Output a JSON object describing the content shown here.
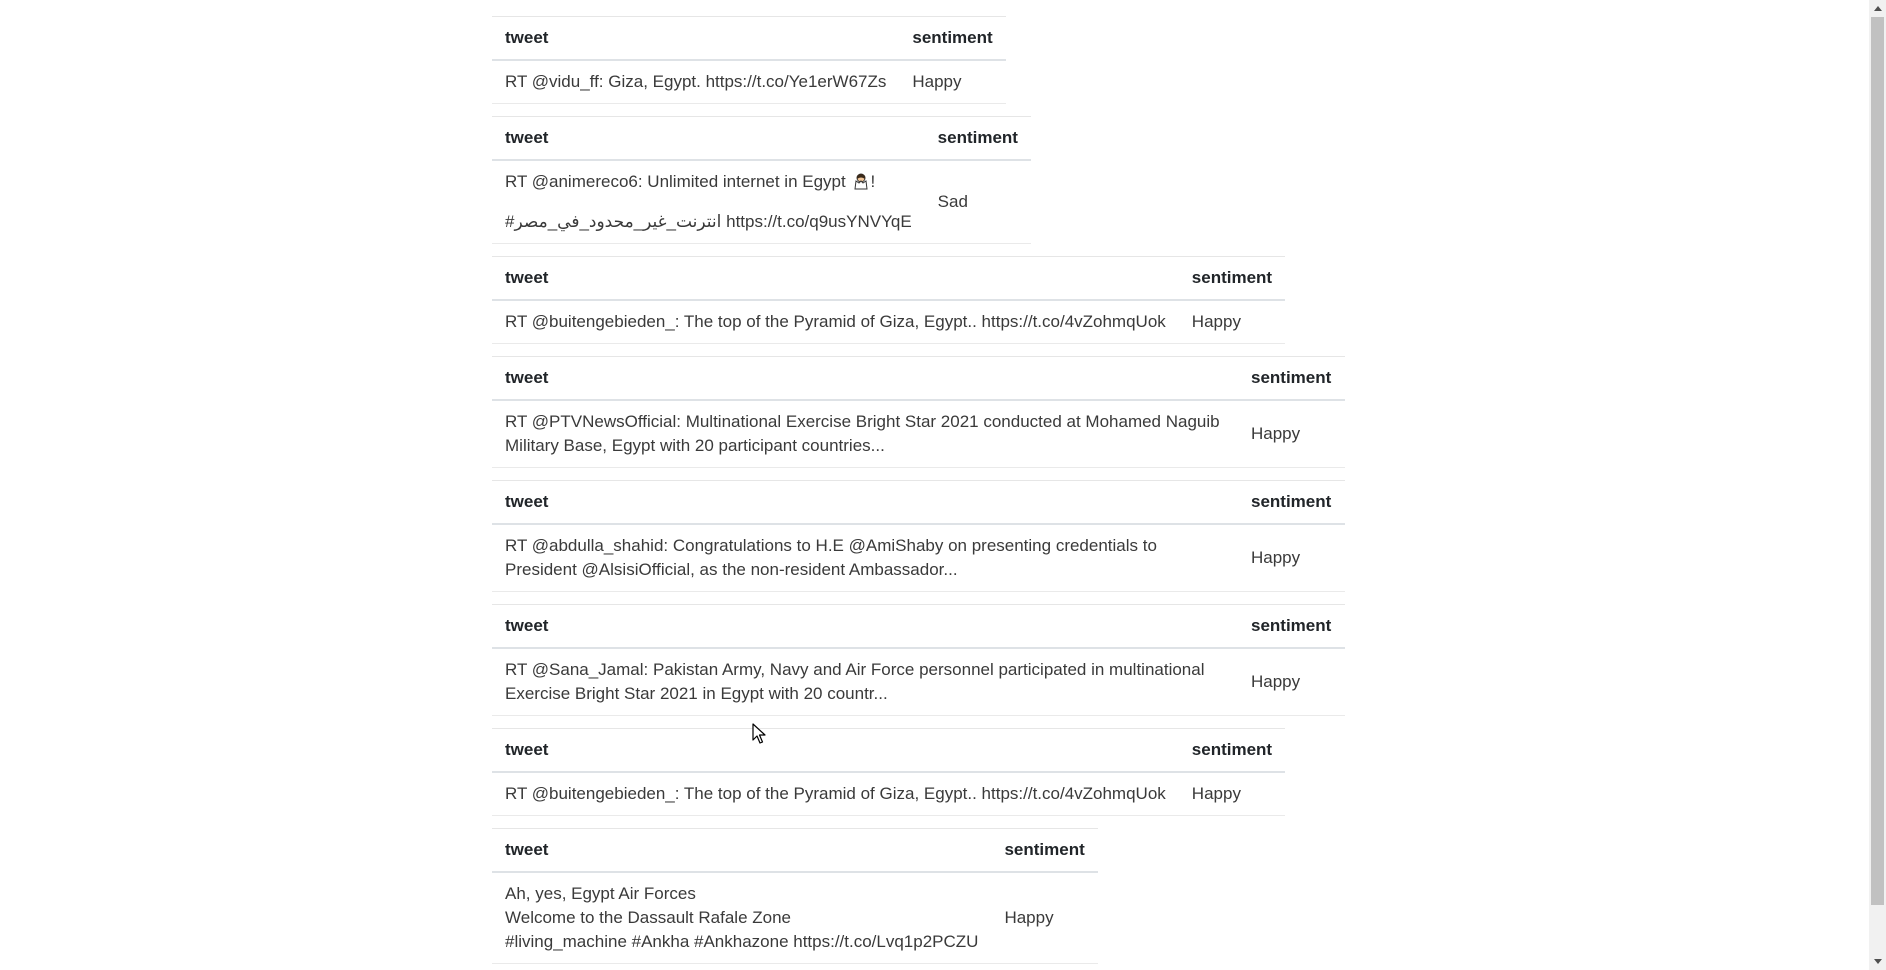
{
  "columns": {
    "tweet": "tweet",
    "sentiment": "sentiment"
  },
  "tables": [
    {
      "tweet": "RT @vidu_ff: Giza, Egypt. https://t.co/Ye1erW67Zs",
      "sentiment": "Happy"
    },
    {
      "tweet_line1": "RT @animereco6: Unlimited internet in Egypt",
      "tweet_line1_suffix": "!",
      "emoji": "person-gesturing-icon",
      "tweet_line2": "#انترنت_غير_محدود_في_مصر https://t.co/q9usYNVYqE",
      "sentiment": "Sad"
    },
    {
      "tweet": "RT @buitengebieden_: The top of the Pyramid of Giza, Egypt.. https://t.co/4vZohmqUok",
      "sentiment": "Happy"
    },
    {
      "tweet": "RT @PTVNewsOfficial: Multinational Exercise Bright Star 2021 conducted at Mohamed Naguib Military Base, Egypt with 20 participant countries...",
      "sentiment": "Happy"
    },
    {
      "tweet": "RT @abdulla_shahid: Congratulations to H.E @AmiShaby on presenting credentials to President @AlsisiOfficial, as the non-resident Ambassador...",
      "sentiment": "Happy"
    },
    {
      "tweet": "RT @Sana_Jamal: Pakistan Army, Navy and Air Force personnel participated in multinational Exercise Bright Star 2021 in Egypt with 20 countr...",
      "sentiment": "Happy"
    },
    {
      "tweet": "RT @buitengebieden_: The top of the Pyramid of Giza, Egypt.. https://t.co/4vZohmqUok",
      "sentiment": "Happy"
    },
    {
      "tweet": "Ah, yes, Egypt Air Forces\nWelcome to the Dassault Rafale Zone\n#living_machine #Ankha #Ankhazone https://t.co/Lvq1p2PCZU",
      "sentiment": "Happy"
    }
  ]
}
